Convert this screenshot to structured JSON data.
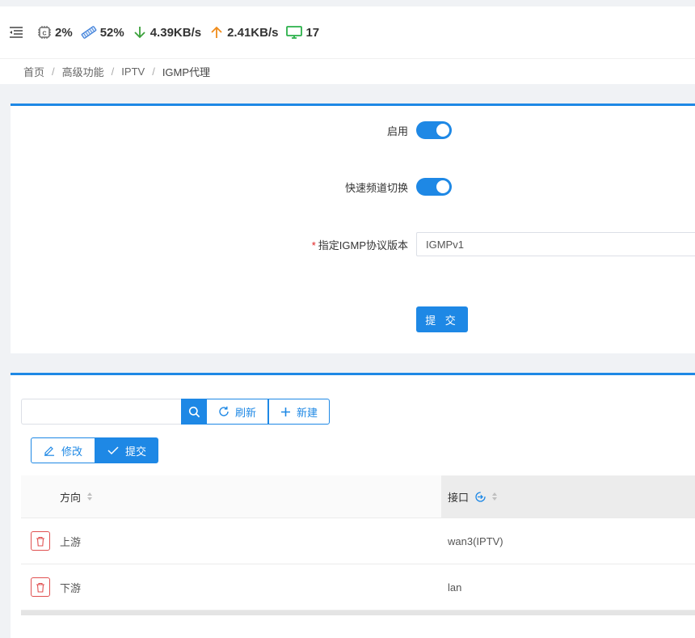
{
  "status": {
    "cpu": "2%",
    "memory": "52%",
    "download": "4.39KB/s",
    "upload": "2.41KB/s",
    "terminals": "17"
  },
  "breadcrumb": [
    "首页",
    "高级功能",
    "IPTV",
    "IGMP代理"
  ],
  "form": {
    "enable_label": "启用",
    "enable_on": true,
    "fast_switch_label": "快速频道切换",
    "fast_switch_on": true,
    "version_label": "指定IGMP协议版本",
    "version_value": "IGMPv1",
    "submit_label": "提 交"
  },
  "toolbar": {
    "search_placeholder": "",
    "refresh_label": "刷新",
    "new_label": "新建",
    "edit_label": "修改",
    "commit_label": "提交"
  },
  "table": {
    "columns": [
      "方向",
      "接口"
    ],
    "rows": [
      {
        "direction": "上游",
        "interface": "wan3(IPTV)"
      },
      {
        "direction": "下游",
        "interface": "lan"
      }
    ]
  },
  "colors": {
    "accent": "#1e88e5",
    "delete": "#e05050"
  }
}
